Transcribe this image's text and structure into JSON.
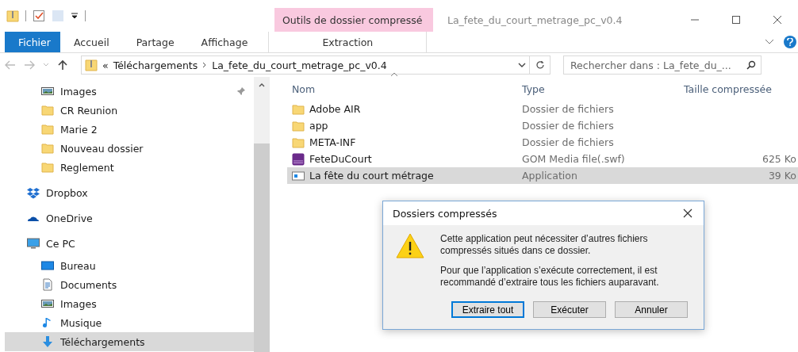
{
  "window": {
    "title": "La_fete_du_court_metrage_pc_v0.4",
    "context_tab_group": "Outils de dossier compressé"
  },
  "ribbon_tabs": [
    {
      "label": "Fichier",
      "kind": "file",
      "selected": false
    },
    {
      "label": "Accueil",
      "kind": "tab",
      "selected": false
    },
    {
      "label": "Partage",
      "kind": "tab",
      "selected": false
    },
    {
      "label": "Affichage",
      "kind": "tab",
      "selected": false
    },
    {
      "label": "Extraction",
      "kind": "context",
      "selected": false
    }
  ],
  "address": {
    "overflow": "«",
    "path": [
      "Téléchargements",
      "La_fete_du_court_metrage_pc_v0.4"
    ]
  },
  "search": {
    "placeholder": "Rechercher dans : La_fete_du_..."
  },
  "sidebar": {
    "quick_access": [
      {
        "label": "Images",
        "kind": "images",
        "pinned": true,
        "selected": false
      },
      {
        "label": "CR Reunion",
        "kind": "folder",
        "pinned": false,
        "selected": false
      },
      {
        "label": "Marie 2",
        "kind": "folder",
        "pinned": false,
        "selected": false
      },
      {
        "label": "Nouveau dossier",
        "kind": "folder",
        "pinned": false,
        "selected": false
      },
      {
        "label": "Reglement",
        "kind": "folder",
        "pinned": false,
        "selected": false
      }
    ],
    "locations": [
      {
        "label": "Dropbox",
        "kind": "dropbox",
        "selected": false
      },
      {
        "label": "OneDrive",
        "kind": "onedrive",
        "selected": false
      },
      {
        "label": "Ce PC",
        "kind": "pc",
        "selected": false,
        "children": [
          {
            "label": "Bureau",
            "kind": "desktop",
            "selected": false
          },
          {
            "label": "Documents",
            "kind": "documents",
            "selected": false
          },
          {
            "label": "Images",
            "kind": "images",
            "selected": false
          },
          {
            "label": "Musique",
            "kind": "music",
            "selected": false
          },
          {
            "label": "Téléchargements",
            "kind": "download",
            "selected": true
          }
        ]
      }
    ]
  },
  "file_list": {
    "columns": [
      "Nom",
      "Type",
      "Taille compressée"
    ],
    "rows": [
      {
        "name": "Adobe AIR",
        "kind": "folder",
        "type": "Dossier de fichiers",
        "selected": false
      },
      {
        "name": "app",
        "kind": "folder",
        "type": "Dossier de fichiers",
        "selected": false
      },
      {
        "name": "META-INF",
        "kind": "folder",
        "type": "Dossier de fichiers",
        "selected": false
      },
      {
        "name": "FeteDuCourt",
        "kind": "swf",
        "type": "GOM Media file(.swf)",
        "size": "625 Ko",
        "selected": false
      },
      {
        "name": "La fête du court métrage",
        "kind": "app",
        "type": "Application",
        "size": "39 Ko",
        "selected": true
      }
    ]
  },
  "dialog": {
    "title": "Dossiers compressés",
    "paragraphs": [
      "Cette application peut nécessiter d’autres fichiers compressés situés dans ce dossier.",
      "Pour que l’application s’exécute correctement, il est recommandé d’extraire tous les fichiers auparavant."
    ],
    "buttons": [
      {
        "label": "Extraire tout",
        "default": true
      },
      {
        "label": "Exécuter",
        "default": false
      },
      {
        "label": "Annuler",
        "default": false
      }
    ]
  }
}
